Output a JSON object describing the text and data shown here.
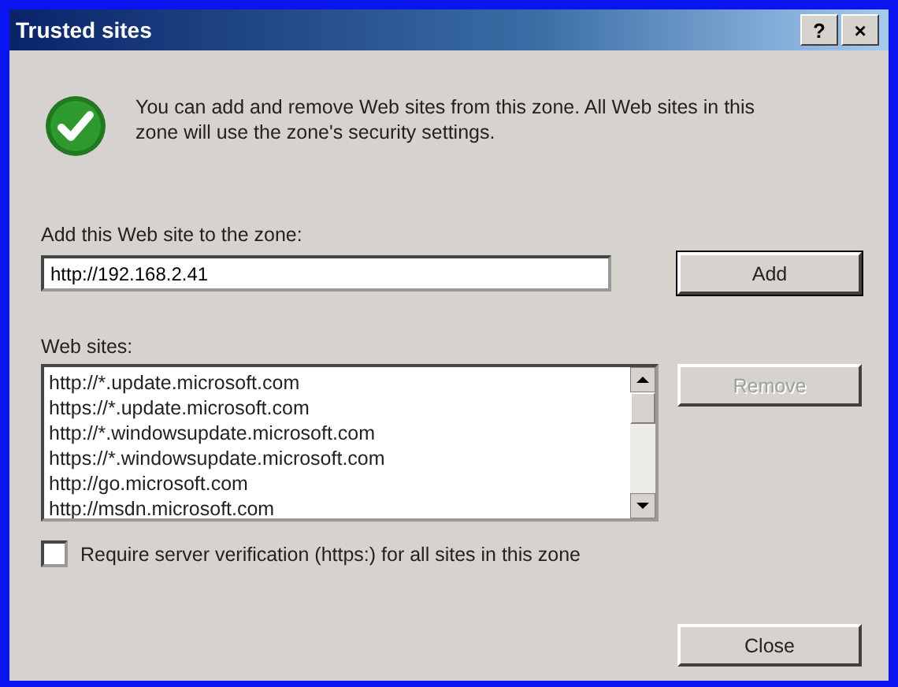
{
  "window": {
    "title": "Trusted sites",
    "help_button": "?",
    "close_button": "×"
  },
  "intro": "You can add and remove Web sites from this zone. All Web sites in this zone will use the zone's security settings.",
  "add_field": {
    "label": "Add this Web site to the zone:",
    "value": "http://192.168.2.41"
  },
  "add_button": {
    "label": "Add",
    "disabled": false
  },
  "sites": {
    "label": "Web sites:",
    "items": [
      {
        "url": "http://*.update.microsoft.com"
      },
      {
        "url": "https://*.update.microsoft.com"
      },
      {
        "url": "http://*.windowsupdate.microsoft.com"
      },
      {
        "url": "https://*.windowsupdate.microsoft.com"
      },
      {
        "url": "http://go.microsoft.com"
      },
      {
        "url": "http://msdn.microsoft.com"
      }
    ]
  },
  "remove_button": {
    "label": "Remove",
    "disabled": true
  },
  "require_https": {
    "label": "Require server verification (https:) for all sites in this zone",
    "checked": false
  },
  "close_button": {
    "label": "Close",
    "disabled": false
  }
}
